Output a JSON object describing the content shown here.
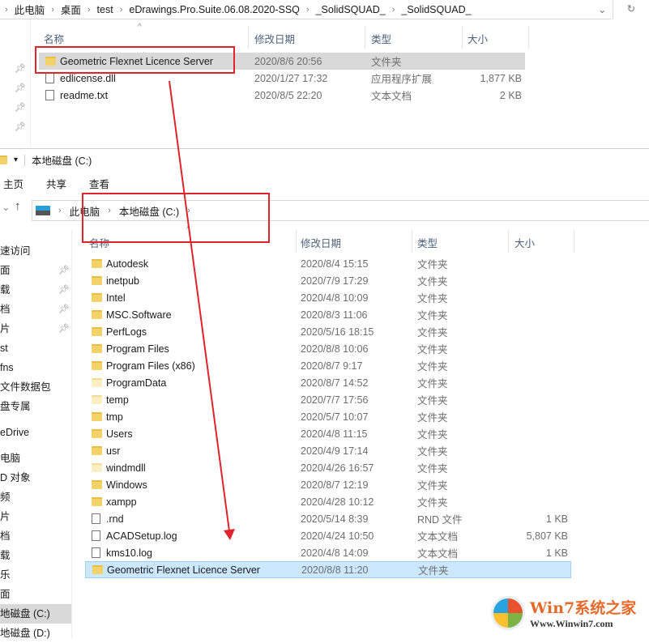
{
  "top_window": {
    "breadcrumb": [
      "此电脑",
      "桌面",
      "test",
      "eDrawings.Pro.Suite.06.08.2020-SSQ",
      "_SolidSQUAD_",
      "_SolidSQUAD_"
    ],
    "columns": {
      "name": "名称",
      "date": "修改日期",
      "type": "类型",
      "size": "大小"
    },
    "files": [
      {
        "name": "Geometric Flexnet Licence Server",
        "date": "2020/8/6 20:56",
        "type": "文件夹",
        "size": "",
        "icon": "folder-icon"
      },
      {
        "name": "edlicense.dll",
        "date": "2020/1/27 17:32",
        "type": "应用程序扩展",
        "size": "1,877 KB",
        "icon": "dll-icon"
      },
      {
        "name": "readme.txt",
        "date": "2020/8/5 22:20",
        "type": "文本文档",
        "size": "2 KB",
        "icon": "text-file-icon"
      }
    ]
  },
  "bottom_window": {
    "title": "本地磁盘 (C:)",
    "ribbon_tabs": [
      "主页",
      "共享",
      "查看"
    ],
    "breadcrumb": [
      "此电脑",
      "本地磁盘 (C:)"
    ],
    "columns": {
      "name": "名称",
      "date": "修改日期",
      "type": "类型",
      "size": "大小"
    },
    "sidebar": [
      "速访问",
      "面",
      "载",
      "档",
      "片",
      "st",
      "fns",
      "文件数据包",
      "盘专属",
      "eDrive",
      "电脑",
      "D 对象",
      "频",
      "片",
      "档",
      "载",
      "乐",
      "面",
      "地磁盘 (C:)",
      "地磁盘 (D:)"
    ],
    "files": [
      {
        "name": "Autodesk",
        "date": "2020/8/4 15:15",
        "type": "文件夹",
        "size": "",
        "icon": "folder"
      },
      {
        "name": "inetpub",
        "date": "2020/7/9 17:29",
        "type": "文件夹",
        "size": "",
        "icon": "folder"
      },
      {
        "name": "Intel",
        "date": "2020/4/8 10:09",
        "type": "文件夹",
        "size": "",
        "icon": "folder"
      },
      {
        "name": "MSC.Software",
        "date": "2020/8/3 11:06",
        "type": "文件夹",
        "size": "",
        "icon": "folder"
      },
      {
        "name": "PerfLogs",
        "date": "2020/5/16 18:15",
        "type": "文件夹",
        "size": "",
        "icon": "folder"
      },
      {
        "name": "Program Files",
        "date": "2020/8/8 10:06",
        "type": "文件夹",
        "size": "",
        "icon": "folder"
      },
      {
        "name": "Program Files (x86)",
        "date": "2020/8/7 9:17",
        "type": "文件夹",
        "size": "",
        "icon": "folder"
      },
      {
        "name": "ProgramData",
        "date": "2020/8/7 14:52",
        "type": "文件夹",
        "size": "",
        "icon": "folder-light"
      },
      {
        "name": "temp",
        "date": "2020/7/7 17:56",
        "type": "文件夹",
        "size": "",
        "icon": "folder-light"
      },
      {
        "name": "tmp",
        "date": "2020/5/7 10:07",
        "type": "文件夹",
        "size": "",
        "icon": "folder"
      },
      {
        "name": "Users",
        "date": "2020/4/8 11:15",
        "type": "文件夹",
        "size": "",
        "icon": "folder"
      },
      {
        "name": "usr",
        "date": "2020/4/9 17:14",
        "type": "文件夹",
        "size": "",
        "icon": "folder"
      },
      {
        "name": "windmdll",
        "date": "2020/4/26 16:57",
        "type": "文件夹",
        "size": "",
        "icon": "folder-light"
      },
      {
        "name": "Windows",
        "date": "2020/8/7 12:19",
        "type": "文件夹",
        "size": "",
        "icon": "folder"
      },
      {
        "name": "xampp",
        "date": "2020/4/28 10:12",
        "type": "文件夹",
        "size": "",
        "icon": "folder"
      },
      {
        "name": ".rnd",
        "date": "2020/5/14 8:39",
        "type": "RND 文件",
        "size": "1 KB",
        "icon": "file"
      },
      {
        "name": "ACADSetup.log",
        "date": "2020/4/24 10:50",
        "type": "文本文档",
        "size": "5,807 KB",
        "icon": "file"
      },
      {
        "name": "kms10.log",
        "date": "2020/4/8 14:09",
        "type": "文本文档",
        "size": "1 KB",
        "icon": "file"
      },
      {
        "name": "Geometric Flexnet Licence Server",
        "date": "2020/8/8 11:20",
        "type": "文件夹",
        "size": "",
        "icon": "folder"
      }
    ]
  },
  "watermark": {
    "brand": "Win7系统之家",
    "url": "Www.Winwin7.com"
  },
  "colors": {
    "annotation": "#e0242b",
    "selected_row": "#cce8ff",
    "hover_row": "#d9d9d9"
  }
}
